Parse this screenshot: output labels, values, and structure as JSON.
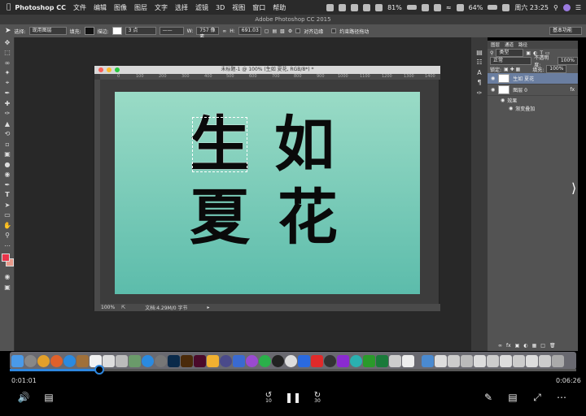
{
  "menubar": {
    "app_name": "Photoshop CC",
    "items": [
      "文件",
      "编辑",
      "图像",
      "图层",
      "文字",
      "选择",
      "滤镜",
      "3D",
      "视图",
      "窗口",
      "帮助"
    ],
    "battery_left": "81%",
    "battery_right": "64%",
    "clock": "周六 23:25"
  },
  "ps": {
    "window_title": "Adobe Photoshop CC 2015",
    "options": {
      "select_label": "选择:",
      "select_value": "现用图层",
      "fill_label": "填充:",
      "stroke_label": "描边:",
      "stroke_size": "3 点",
      "w_label": "W:",
      "w_value": "757 像素",
      "h_label": "H:",
      "h_value": "691.03",
      "align_edges": "对齐边缘",
      "constrain_path": "约束路径拖动",
      "workspace": "基本功能"
    },
    "document": {
      "title": "未标题-1 @ 100% (生如 夏花, RGB/8*) *",
      "ruler_marks": [
        "0",
        "100",
        "200",
        "300",
        "400",
        "500",
        "600",
        "700",
        "800",
        "900",
        "1000",
        "1100",
        "1200",
        "1300",
        "1400",
        "1500"
      ],
      "chars": [
        "生",
        "如",
        "夏",
        "花"
      ],
      "zoom": "100%",
      "doc_info": "文档:4.29M/0 字节"
    },
    "panels": {
      "tabs": [
        "图层",
        "通道",
        "路径"
      ],
      "kind": "类型",
      "blend": "正常",
      "opacity_label": "不透明度:",
      "opacity": "100%",
      "lock_label": "锁定:",
      "fill_label": "填充:",
      "fill": "100%",
      "layers": [
        {
          "name": "生如 夏花"
        },
        {
          "name": "图层 0"
        }
      ],
      "effects_label": "效果",
      "gradient_overlay": "渐变叠加",
      "fx": "fx"
    }
  },
  "player": {
    "time_elapsed": "0:01:01",
    "time_total": "0:06:26",
    "progress": 0.158,
    "skip_back": "10",
    "skip_forward": "30"
  },
  "colors": {
    "accent": "#2d87e0",
    "canvas_top": "#9adbc6",
    "canvas_bottom": "#5cbcab",
    "fg_swatch": "#e8344a"
  }
}
